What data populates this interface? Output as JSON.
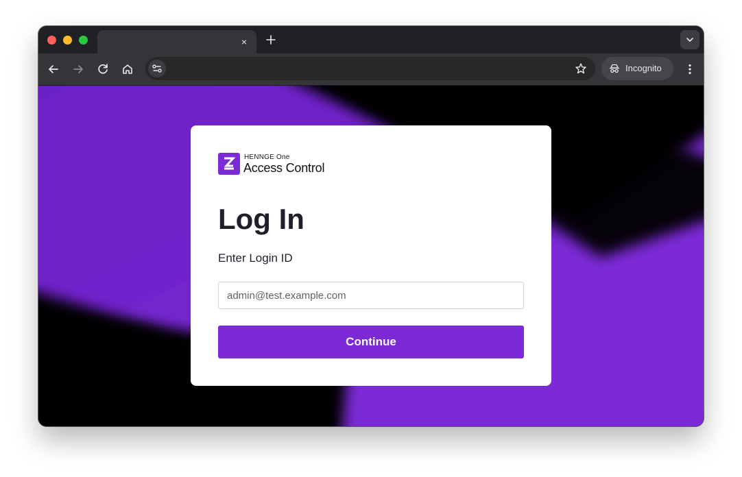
{
  "browser": {
    "tab_close_glyph": "×",
    "new_tab_glyph": "+",
    "incognito_label": "Incognito",
    "address_value": ""
  },
  "card": {
    "brand_name": "HENNGE One",
    "product_name": "Access Control",
    "title": "Log In",
    "subtitle": "Enter Login ID",
    "login_input_value": "",
    "login_input_placeholder": "admin@test.example.com",
    "continue_label": "Continue"
  },
  "colors": {
    "accent": "#7b2ad6",
    "browser_frame": "#202124",
    "toolbar": "#35363a",
    "background": "#000000"
  },
  "icons": {
    "traffic_lights": [
      "close-window-icon",
      "minimize-window-icon",
      "maximize-window-icon"
    ],
    "toolbar": [
      "back-arrow-icon",
      "forward-arrow-icon",
      "reload-icon",
      "home-icon",
      "site-info-icon",
      "bookmark-star-icon",
      "incognito-icon",
      "more-menu-icon"
    ]
  }
}
